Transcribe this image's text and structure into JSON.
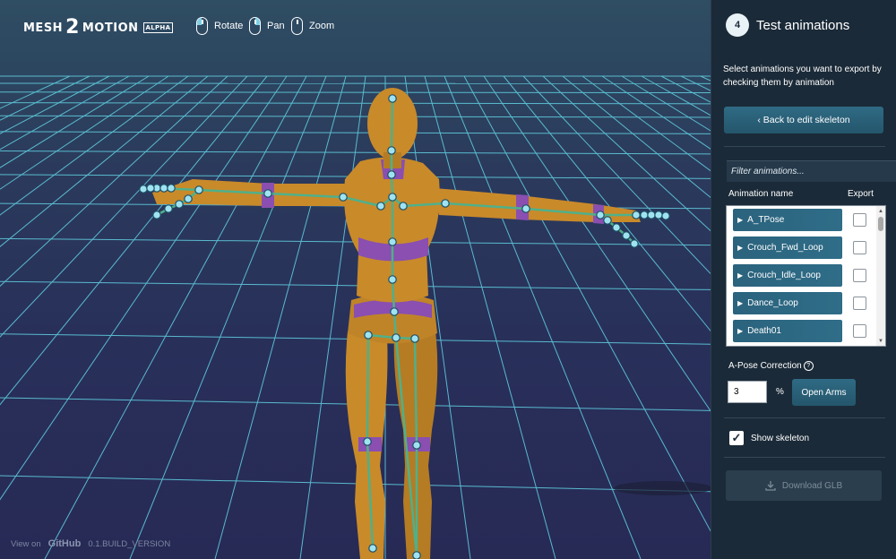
{
  "app": {
    "logo_part1": "MESH",
    "logo_part2": "2",
    "logo_part3": "MOTION",
    "logo_badge": "ALPHA"
  },
  "controls": [
    {
      "label": "Rotate",
      "icon": "mouse-left-button-icon"
    },
    {
      "label": "Pan",
      "icon": "mouse-right-button-icon"
    },
    {
      "label": "Zoom",
      "icon": "mouse-scroll-icon"
    }
  ],
  "footer": {
    "view_on": "View on",
    "github": "GitHub",
    "version": "0.1.BUILD_VERSION"
  },
  "panel": {
    "step_number": "4",
    "step_title": "Test animations",
    "instructions": "Select animations you want to export by checking them by animation",
    "back_button": "‹ Back to edit skeleton",
    "filter_placeholder": "Filter animations...",
    "col_name": "Animation name",
    "col_export": "Export",
    "animations": [
      {
        "name": "A_TPose",
        "exported": false
      },
      {
        "name": "Crouch_Fwd_Loop",
        "exported": false
      },
      {
        "name": "Crouch_Idle_Loop",
        "exported": false
      },
      {
        "name": "Dance_Loop",
        "exported": false
      },
      {
        "name": "Death01",
        "exported": false
      }
    ],
    "apose_label": "A-Pose Correction",
    "apose_value": "3",
    "apose_unit": "%",
    "open_arms_button": "Open Arms",
    "show_skeleton_label": "Show skeleton",
    "show_skeleton_checked": true,
    "download_button": "Download GLB"
  },
  "colors": {
    "panel_bg": "#1b2a38",
    "accent_button": "#2b637d",
    "skeleton_joint": "#9fe3f0",
    "skeleton_bone": "#4fb08a",
    "mannequin": "#c98a2a",
    "mannequin_purple": "#8a4fb0",
    "grid": "#5fc9db"
  }
}
